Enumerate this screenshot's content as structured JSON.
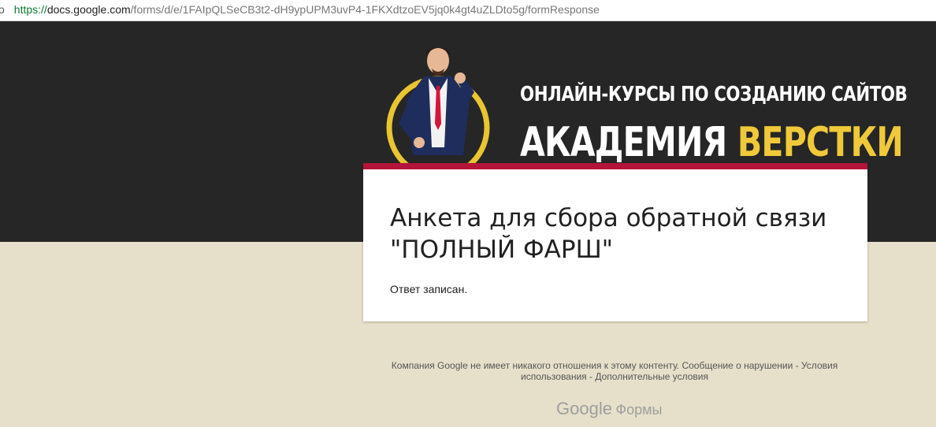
{
  "browser": {
    "url_truncated": "o",
    "url_protocol": "https://",
    "url_host": "docs.google.com",
    "url_path": "/forms/d/e/1FAIpQLSeCB3t2-dH9ypUPM3uvP4-1FKXdtzoEV5jq0k4gt4uZLDto5g/formResponse"
  },
  "banner": {
    "line1": "ОНЛАЙН-КУРСЫ ПО СОЗДАНИЮ САЙТОВ",
    "line2_white": "АКАДЕМИЯ",
    "line2_yellow": "ВЕРСТКИ",
    "background": "#262626",
    "ring_color": "#e8c531",
    "accent_yellow": "#f0c93a"
  },
  "form": {
    "title": "Анкета для сбора обратной связи \"ПОЛНЫЙ ФАРШ\"",
    "confirmation": "Ответ записан.",
    "accent_color": "#b5143a"
  },
  "footer": {
    "disclaimer": "Компания Google не имеет никакого отношения к этому контенту.",
    "report_link": "Сообщение о нарушении",
    "sep": "-",
    "terms_link": "Условия использования",
    "additional_link": "Дополнительные условия",
    "brand_google": "Google",
    "brand_forms": "Формы"
  },
  "page": {
    "background": "#e6e0ca"
  }
}
